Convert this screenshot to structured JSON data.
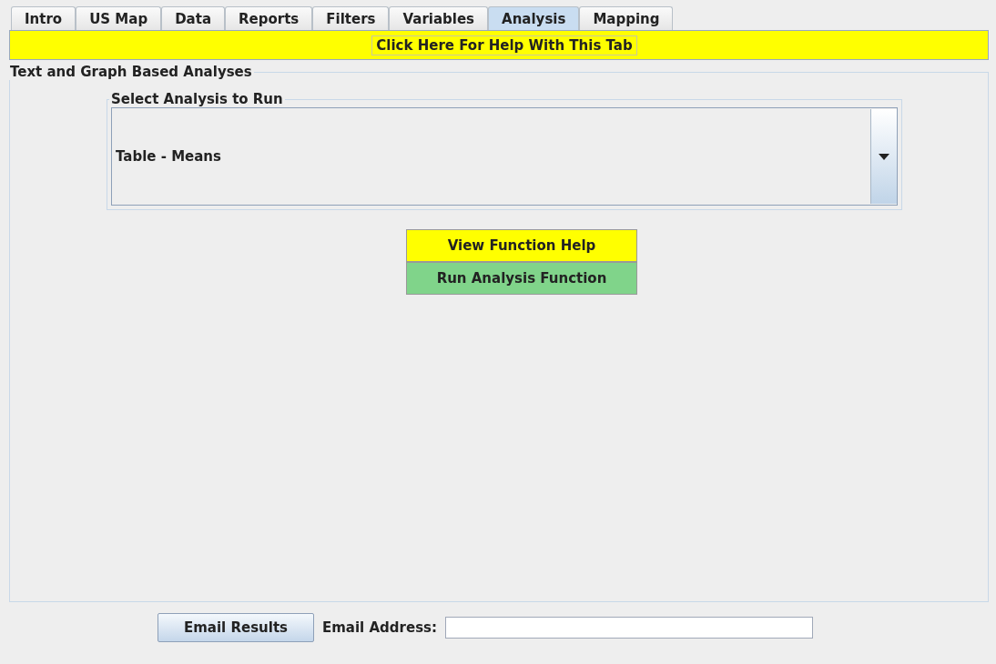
{
  "tabs": [
    {
      "label": "Intro",
      "selected": false
    },
    {
      "label": "US Map",
      "selected": false
    },
    {
      "label": "Data",
      "selected": false
    },
    {
      "label": "Reports",
      "selected": false
    },
    {
      "label": "Filters",
      "selected": false
    },
    {
      "label": "Variables",
      "selected": false
    },
    {
      "label": "Analysis",
      "selected": true
    },
    {
      "label": "Mapping",
      "selected": false
    }
  ],
  "help_button": "Click Here For Help With This Tab",
  "panel": {
    "title": "Text and Graph Based Analyses",
    "analysis_group": {
      "title": "Select Analysis to Run",
      "selected_value": "Table - Means"
    },
    "buttons": [
      {
        "label": "View Function Help",
        "color": "#ffff00"
      },
      {
        "label": "Run Analysis Function",
        "color": "#80d48a"
      }
    ]
  },
  "footer": {
    "email_button": "Email Results",
    "email_label": "Email Address:"
  }
}
